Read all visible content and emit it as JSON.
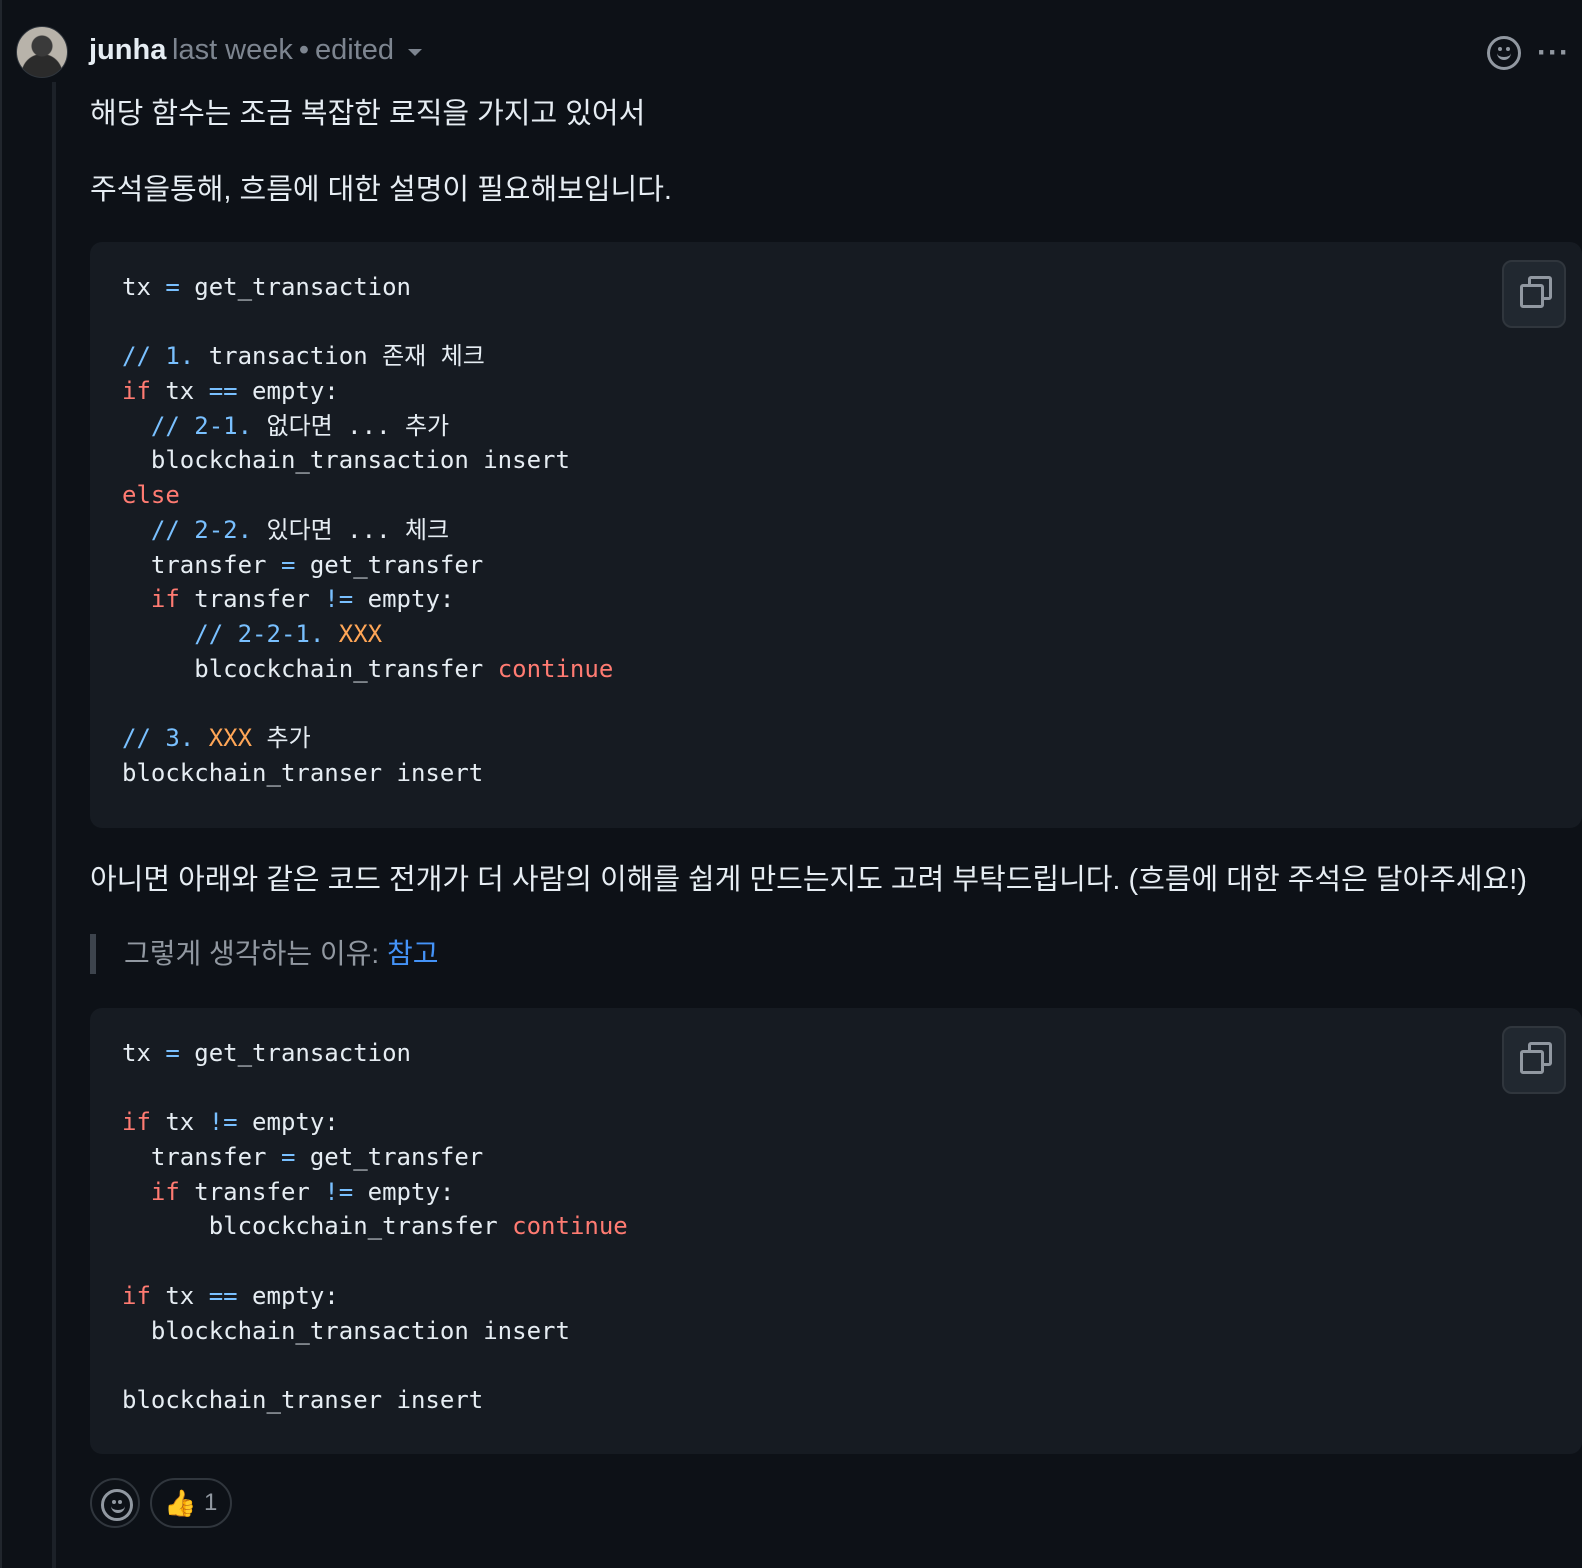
{
  "comment": {
    "author": "junha",
    "time": "last week",
    "edited": "edited",
    "separator": "•",
    "more_icon": "kebab-horizontal-icon",
    "reaction_icon": "smiley-icon"
  },
  "body": {
    "paragraph1": "해당 함수는 조금 복잡한 로직을 가지고 있어서",
    "paragraph2": "주석을통해, 흐름에 대한 설명이 필요해보입니다.",
    "paragraph3": "아니면 아래와 같은 코드 전개가 더 사람의 이해를 쉽게 만드는지도 고려 부탁드립니다. (흐름에 대한 주석은 달아주세요!)",
    "quote_text": "그렇게 생각하는 이유: ",
    "quote_link": "참고"
  },
  "code1": {
    "l1": {
      "a": "tx ",
      "op": "=",
      "b": " get_transaction"
    },
    "l3": {
      "cm": "// 1.",
      "b": " transaction 존재 체크"
    },
    "l4": {
      "kw": "if",
      "a": " tx ",
      "op": "==",
      "b": " empty:"
    },
    "l5": {
      "cm": "  // 2-1.",
      "b": " 없다면 ... 추가"
    },
    "l6": {
      "a": "  blockchain_transaction insert"
    },
    "l7": {
      "kw": "else"
    },
    "l8": {
      "cm": "  // 2-2.",
      "b": " 있다면 ... 체크"
    },
    "l9": {
      "a": "  transfer ",
      "op": "=",
      "b": " get_transfer"
    },
    "l10": {
      "kw": "  if",
      "a": " transfer ",
      "op": "!=",
      "b": " empty:"
    },
    "l11": {
      "cm": "     // 2-2-1.",
      "hl": " XXX"
    },
    "l12": {
      "a": "     blcockchain_transfer ",
      "kw": "continue"
    },
    "l14": {
      "cm": "// 3.",
      "hl": " XXX",
      "b": " 추가"
    },
    "l15": {
      "a": "blockchain_transer insert"
    }
  },
  "code2": {
    "l1": {
      "a": "tx ",
      "op": "=",
      "b": " get_transaction"
    },
    "l3": {
      "kw": "if",
      "a": " tx ",
      "op": "!=",
      "b": " empty:"
    },
    "l4": {
      "a": "  transfer ",
      "op": "=",
      "b": " get_transfer"
    },
    "l5": {
      "kw": "  if",
      "a": " transfer ",
      "op": "!=",
      "b": " empty:"
    },
    "l6": {
      "a": "      blcockchain_transfer ",
      "kw": "continue"
    },
    "l8": {
      "kw": "if",
      "a": " tx ",
      "op": "==",
      "b": " empty:"
    },
    "l9": {
      "a": "  blockchain_transaction insert"
    },
    "l11": {
      "a": "blockchain_transer insert"
    }
  },
  "reactions": {
    "thumbs_up_emoji": "👍",
    "thumbs_up_count": "1"
  }
}
